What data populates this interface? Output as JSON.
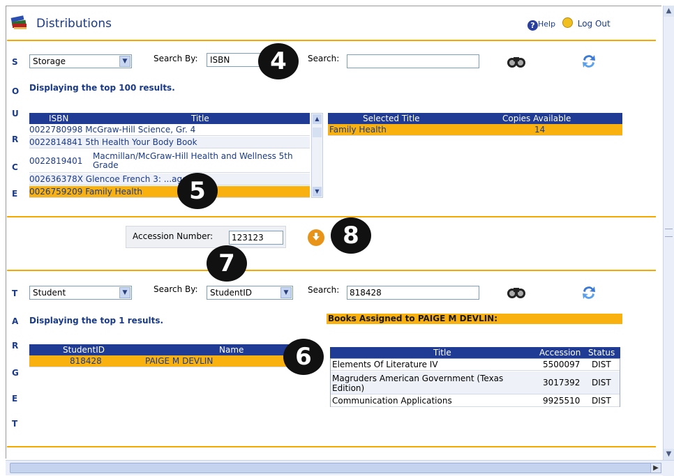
{
  "header": {
    "title": "Distributions",
    "help": "Help",
    "logout": "Log Out"
  },
  "source": {
    "side_letters": [
      "S",
      "O",
      "U",
      "R",
      "C",
      "E"
    ],
    "type_select": "Storage",
    "search_by_label": "Search By:",
    "search_by_select": "ISBN",
    "search_label": "Search:",
    "search_value": "",
    "display_text": "Displaying the top 100 results.",
    "columns": [
      "ISBN",
      "Title"
    ],
    "rows": [
      {
        "isbn": "0022780998",
        "title": "McGraw-Hill Science, Gr. 4"
      },
      {
        "isbn": "0022814841",
        "title": "5th Health Your Body Book"
      },
      {
        "isbn": "0022819401",
        "title": "Macmillan/McGraw-Hill Health and Wellness 5th Grade"
      },
      {
        "isbn": "002636378X",
        "title": "Glencoe French 3: ...age"
      },
      {
        "isbn": "0026759209",
        "title": "Family Health"
      }
    ],
    "selected_columns": [
      "Selected Title",
      "Copies Available"
    ],
    "selected_row": {
      "title": "Family Health",
      "copies": "14"
    }
  },
  "accession": {
    "label": "Accession Number:",
    "value": "123123"
  },
  "target": {
    "side_letters": [
      "T",
      "A",
      "R",
      "G",
      "E",
      "T"
    ],
    "type_select": "Student",
    "search_by_label": "Search By:",
    "search_by_select": "StudentID",
    "search_label": "Search:",
    "search_value": "818428",
    "display_text": "Displaying the top 1 results.",
    "assigned_banner": "Books Assigned to PAIGE M DEVLIN:",
    "columns": [
      "StudentID",
      "Name"
    ],
    "rows": [
      {
        "id": "818428",
        "name": "PAIGE M DEVLIN"
      }
    ],
    "books_columns": [
      "Title",
      "Accession",
      "Status"
    ],
    "books": [
      {
        "title": "Elements Of Literature IV",
        "accession": "5500097",
        "status": "DIST"
      },
      {
        "title": "Magruders American Government (Texas Edition)",
        "accession": "3017392",
        "status": "DIST"
      },
      {
        "title": "Communication Applications",
        "accession": "9925510",
        "status": "DIST"
      }
    ]
  },
  "callouts": [
    "4",
    "5",
    "6",
    "7",
    "8"
  ]
}
